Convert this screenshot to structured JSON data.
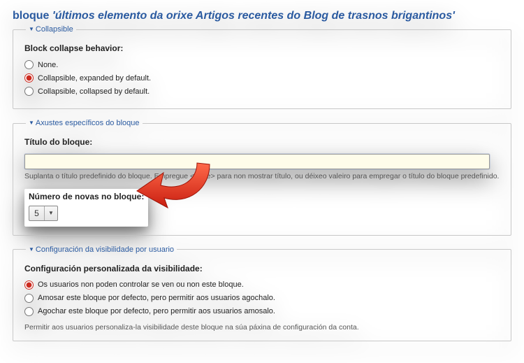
{
  "title_prefix": "bloque ",
  "title_quoted": "'últimos elemento da orixe Artigos recentes do Blog de trasnos brigantinos'",
  "collapsible": {
    "legend": "Collapsible",
    "label": "Block collapse behavior:",
    "options": {
      "none": "None.",
      "expanded": "Collapsible, expanded by default.",
      "collapsed": "Collapsible, collapsed by default."
    },
    "selected": "expanded"
  },
  "block_settings": {
    "legend": "Axustes específicos do bloque",
    "title_label": "Título do bloque:",
    "title_value": "",
    "title_help": "Suplanta o título predefinido do bloque. Empregue <none> para non mostrar título, ou déixeo valeiro para empregar o título do bloque predefinido.",
    "num_label": "Número de novas no bloque:",
    "num_value": "5"
  },
  "visibility": {
    "legend": "Configuración da visibilidade por usuario",
    "label": "Configuración personalizada da visibilidade:",
    "options": {
      "nocontrol": "Os usuarios non poden controlar se ven ou non este bloque.",
      "shown": "Amosar este bloque por defecto, pero permitir aos usuarios agochalo.",
      "hidden": "Agochar este bloque por defecto, pero permitir aos usuarios amosalo."
    },
    "selected": "nocontrol",
    "help": "Permitir aos usuarios personaliza-la visibilidade deste bloque na súa páxina de configuración da conta."
  }
}
